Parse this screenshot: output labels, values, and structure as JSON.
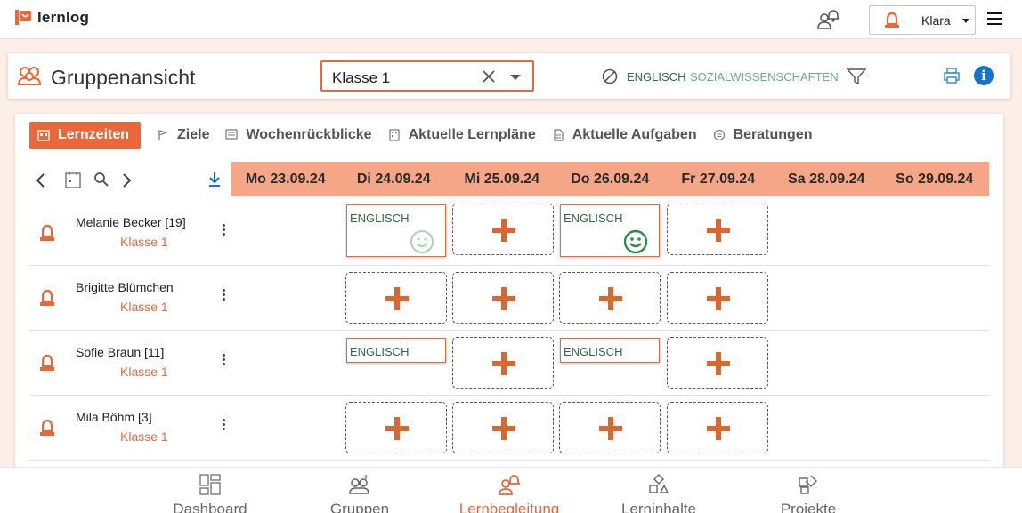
{
  "app": {
    "name": "lernlog",
    "accent": "#e8683a",
    "accent_light": "#f4a687"
  },
  "topbar": {
    "user_name": "Klara",
    "notification_icon": "person-bell-icon",
    "menu_icon": "hamburger-icon"
  },
  "header": {
    "title": "Gruppenansicht",
    "class_select_value": "Klasse 1",
    "subjects": [
      "ENGLISCH",
      "SOZIALWISSENSCHAFTEN"
    ],
    "subject_colors": [
      "#2e6b45",
      "#64b47c"
    ]
  },
  "tabs": [
    {
      "label": "Lernzeiten",
      "icon": "calendar-icon",
      "active": true
    },
    {
      "label": "Ziele",
      "icon": "flag-icon",
      "active": false
    },
    {
      "label": "Wochenrückblicke",
      "icon": "notes-icon",
      "active": false
    },
    {
      "label": "Aktuelle Lernpläne",
      "icon": "plan-icon",
      "active": false
    },
    {
      "label": "Aktuelle Aufgaben",
      "icon": "document-icon",
      "active": false
    },
    {
      "label": "Beratungen",
      "icon": "chat-icon",
      "active": false
    }
  ],
  "days": [
    "Mo 23.09.24",
    "Di 24.09.24",
    "Mi 25.09.24",
    "Do 26.09.24",
    "Fr 27.09.24",
    "Sa 28.09.24",
    "So 29.09.24"
  ],
  "students": [
    {
      "name": "Melanie Becker [19]",
      "class": "Klasse 1"
    },
    {
      "name": "Brigitte Blümchen",
      "class": "Klasse 1"
    },
    {
      "name": "Sofie Braun [11]",
      "class": "Klasse 1"
    },
    {
      "name": "Mila Böhm [3]",
      "class": "Klasse 1"
    }
  ],
  "entries": {
    "r0_di": "ENGLISCH",
    "r0_do": "ENGLISCH",
    "r2_di": "ENGLISCH",
    "r2_do": "ENGLISCH"
  },
  "bottom_nav": [
    {
      "label": "Dashboard",
      "icon": "dashboard-icon"
    },
    {
      "label": "Gruppen",
      "icon": "group-icon"
    },
    {
      "label": "Lernbegleitung",
      "icon": "person-bell-icon",
      "active": true
    },
    {
      "label": "Lerninhalte",
      "icon": "shapes-icon"
    },
    {
      "label": "Projekte",
      "icon": "projects-icon"
    }
  ]
}
